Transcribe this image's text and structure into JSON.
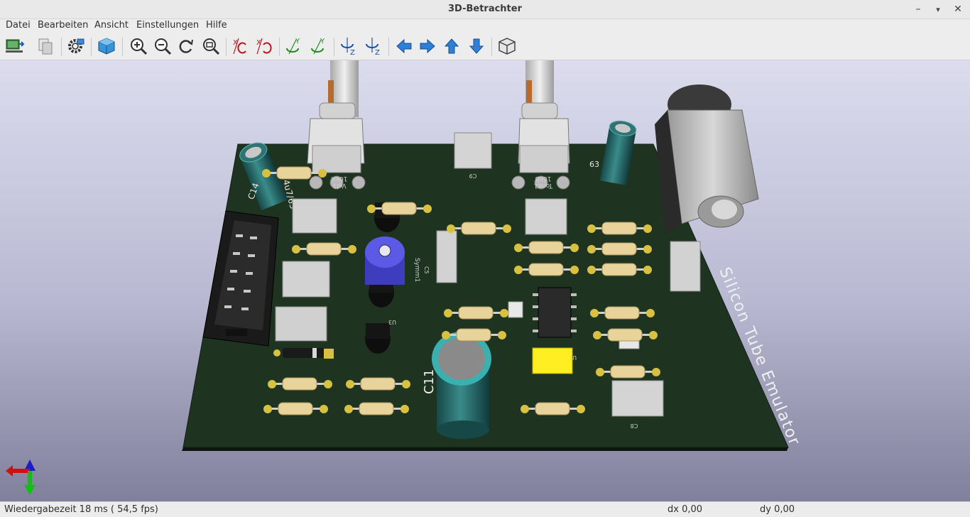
{
  "window": {
    "title": "3D-Betrachter"
  },
  "menu": {
    "items": [
      "Datei",
      "Bearbeiten",
      "Ansicht",
      "Einstellungen",
      "Hilfe"
    ]
  },
  "board": {
    "title_text": "Silicon Tube Emulator",
    "ref_labels": {
      "c14": "C14",
      "c14_value": "4u7/63",
      "c11": "C11",
      "c63": "63",
      "volume": "Vol1",
      "volume_value": "10kA",
      "tone": "Tone1",
      "tone_value": "10kB",
      "symm": "Symm1",
      "c5": "C5",
      "c8": "C8",
      "c9": "C9",
      "u3": "U3",
      "u1": "U1"
    }
  },
  "status": {
    "render_time": "Wiedergabezeit 18 ms ( 54,5 fps)",
    "dx": "dx 0,00",
    "dy": "dy 0,00"
  },
  "colors": {
    "pcb": "#1f3420",
    "pcb_edge": "#0c160c",
    "resistor": "#e8d39a",
    "capacitor": "#2a6e6e",
    "trimmer": "#5656dc",
    "chip": "#ffee22",
    "viewport_top": "#dcdcee",
    "viewport_bottom": "#80809c"
  },
  "icons": [
    "load-board-icon",
    "copy-icon",
    "settings-icon",
    "cube-view-icon",
    "zoom-in-icon",
    "zoom-out-icon",
    "refresh-icon",
    "zoom-fit-icon",
    "rotate-x-cw-icon",
    "rotate-x-ccw-icon",
    "rotate-y-cw-icon",
    "rotate-y-ccw-icon",
    "rotate-z-cw-icon",
    "rotate-z-ccw-icon",
    "move-left-icon",
    "move-right-icon",
    "move-up-icon",
    "move-down-icon",
    "orthographic-icon"
  ]
}
